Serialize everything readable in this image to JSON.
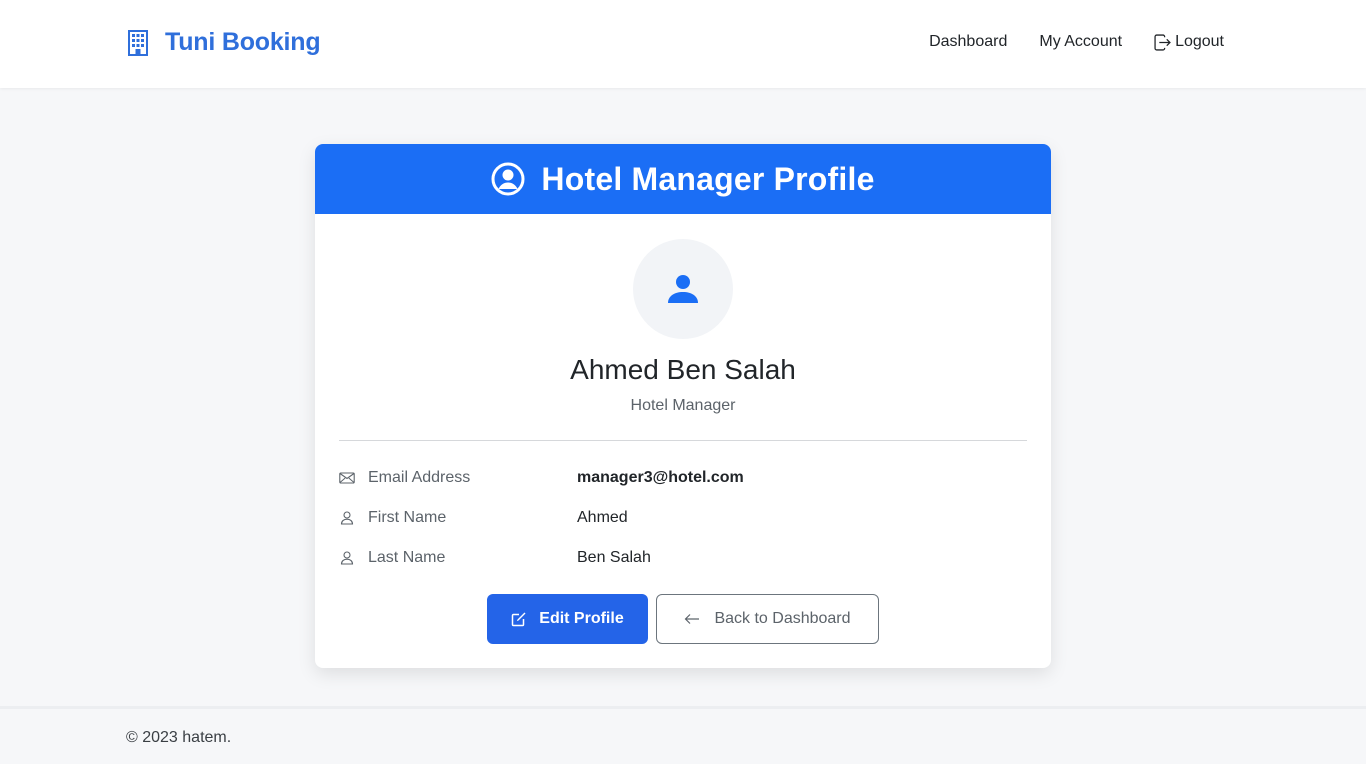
{
  "navbar": {
    "brand": "Tuni Booking",
    "brand_icon": "building-icon",
    "links": [
      "Dashboard",
      "My Account",
      "Logout"
    ],
    "logout_icon": "logout-icon"
  },
  "profile": {
    "title": "Hotel Manager Profile",
    "title_icon": "user-circle-icon",
    "avatar_icon": "person-icon",
    "full_name": "Ahmed Ben Salah",
    "role": "Hotel Manager",
    "fields": [
      {
        "label": "Email Address",
        "value": "manager3@hotel.com",
        "icon": "envelope-icon"
      },
      {
        "label": "First Name",
        "value": "Ahmed",
        "icon": "person-outline-icon"
      },
      {
        "label": "Last Name",
        "value": "Ben Salah",
        "icon": "person-outline-icon"
      }
    ],
    "edit_button": "Edit Profile",
    "back_button": "Back to Dashboard"
  },
  "footer": {
    "text": "© 2023 hatem."
  },
  "colors": {
    "brand": "#2f6fdb",
    "header_bg": "#1b6ef5",
    "primary_button": "#2464e8",
    "avatar_icon": "#1b6ef5"
  }
}
